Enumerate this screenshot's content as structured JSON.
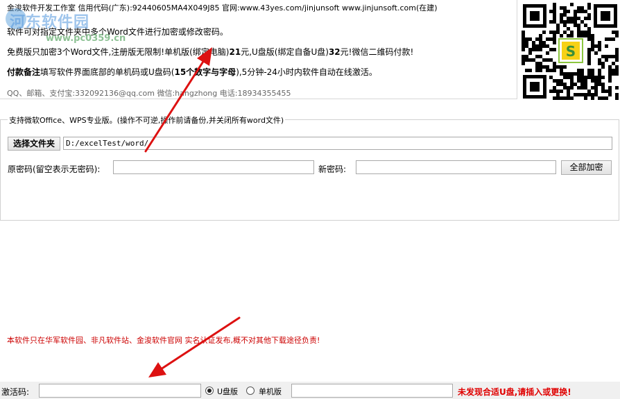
{
  "info": {
    "line1": "金浚软件开发工作室 信用代码(广东):92440605MA4X049J85 官网:www.43yes.com/jinjunsoft  www.jinjunsoft.com(在建)",
    "line2": "软件可对指定文件夹中多个Word文件进行加密或修改密码。",
    "line3_a": "免费版只加密3个Word文件,注册版无限制!单机版(绑定电脑)",
    "line3_b": "21",
    "line3_c": "元,U盘版(绑定自备U盘)",
    "line3_d": "32",
    "line3_e": "元!微信二维码付款!",
    "line4_a": "付款备注",
    "line4_b": "填写软件界面底部的单机码或U盘码(",
    "line4_c": "15个数字与字母",
    "line4_d": "),5分钟-24小时内软件自动在线激活。",
    "line5": "QQ、邮箱、支付宝:332092136@qq.com    微信:hangzhong    电话:18934355455"
  },
  "watermark": {
    "site": "河东软件园",
    "url": "www.pc0359.cn"
  },
  "icons": {
    "qr": "qr-code-icon",
    "radio_selected": "radio-selected-icon",
    "radio_unselected": "radio-unselected-icon"
  },
  "group": {
    "legend": "支持微软Office、WPS专业版。(操作不可逆,操作前请备份,并关闭所有word文件)",
    "select_folder_label": "选择文件夹",
    "folder_path": "D:/excelTest/word/",
    "old_pwd_label": "原密码(留空表示无密码):",
    "old_pwd_value": "",
    "new_pwd_label": "新密码:",
    "new_pwd_value": "",
    "encrypt_all_label": "全部加密"
  },
  "warning": "本软件只在华军软件园、非凡软件站、金浚软件官网 实名认证发布,概不对其他下载途径负责!",
  "bottom": {
    "activation_label": "激活码:",
    "activation_value": "",
    "usb_label": "U盘版",
    "standalone_label": "单机版",
    "machine_code_value": "",
    "status": "未发现合适U盘,请插入或更换!"
  },
  "colors": {
    "warning": "#cc0000",
    "status": "#e00000",
    "arrow": "#dd1111"
  }
}
